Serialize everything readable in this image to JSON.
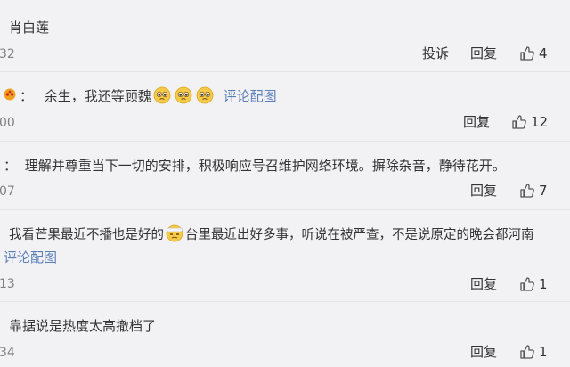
{
  "comments": [
    {
      "text": "肖白莲",
      "time": "32",
      "report_label": "投诉",
      "reply_label": "回复",
      "likes": "4"
    },
    {
      "prefix": "：",
      "text": "余生，我还等顾魏",
      "link": "评论配图",
      "time": "00",
      "reply_label": "回复",
      "likes": "12",
      "emoji": "pleading-face-icon"
    },
    {
      "prefix": "：",
      "text": "理解并尊重当下一切的安排，积极响应号召维护网络环境。摒除杂音，静待花开。",
      "time": "07",
      "reply_label": "回复",
      "likes": "7"
    },
    {
      "text_a": "我看芒果最近不播也是好的",
      "text_b": "台里最近出好多事，听说在被严查，不是说原定的晚会都河南",
      "link": "评论配图",
      "time": "13",
      "reply_label": "回复",
      "likes": "1",
      "emoji": "bandaged-head-face-icon"
    },
    {
      "text": "靠据说是热度太高撤档了",
      "time": "34",
      "reply_label": "回复",
      "likes": "1"
    }
  ],
  "colors": {
    "background": "#f2f2f5",
    "link": "#5a7fb8",
    "time": "#808080"
  }
}
